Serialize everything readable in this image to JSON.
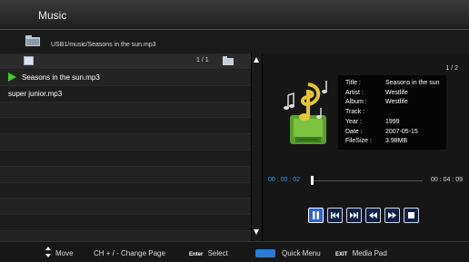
{
  "app": {
    "title": "Music"
  },
  "path": {
    "text": "USB1/music/Seasons in the sun.mp3"
  },
  "list": {
    "page": "1 / 1",
    "items": [
      {
        "label": "Seasons in the sun.mp3",
        "playing": true
      },
      {
        "label": "super junior.mp3",
        "playing": false
      }
    ]
  },
  "details": {
    "page": "1 / 2",
    "info": [
      {
        "key": "Title :",
        "value": "Seasons in the sun"
      },
      {
        "key": "Artist :",
        "value": "Westlife"
      },
      {
        "key": "Album :",
        "value": "Westlife"
      },
      {
        "key": "Track :",
        "value": ""
      },
      {
        "key": "Year :",
        "value": "1999"
      },
      {
        "key": "Date :",
        "value": "2007-05-15"
      },
      {
        "key": "FileSize :",
        "value": "3.98MB"
      }
    ]
  },
  "playback": {
    "current_time": "00 : 00 : 02",
    "total_time": "00 : 04 : 09",
    "progress": 0.008,
    "controls": [
      "pause-icon",
      "previous-icon",
      "next-icon",
      "rewind-icon",
      "fast-forward-icon",
      "stop-icon"
    ]
  },
  "footer": {
    "move": "Move",
    "change_page_key": "CH + / -",
    "change_page": "Change Page",
    "select_key": "Enter",
    "select": "Select",
    "quick_menu": "Quick Menu",
    "media_pad_key": "EXIT",
    "media_pad": "Media Pad"
  },
  "colors": {
    "accent": "#2e9bff",
    "play_marker": "#39d02e",
    "quick_menu": "#2a7bd8"
  }
}
